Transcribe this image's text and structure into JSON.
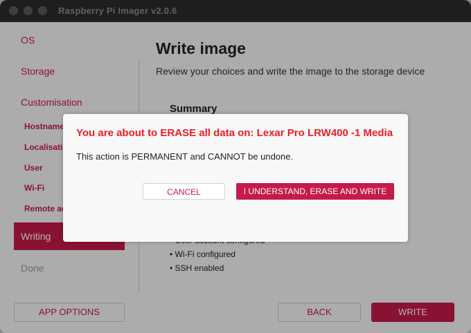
{
  "window": {
    "title": "Raspberry Pi Imager v2.0.6"
  },
  "sidebar": {
    "items": [
      {
        "label": "OS"
      },
      {
        "label": "Storage"
      },
      {
        "label": "Customisation"
      }
    ],
    "sub_items": [
      {
        "label": "Hostname"
      },
      {
        "label": "Localisation"
      },
      {
        "label": "User"
      },
      {
        "label": "Wi-Fi"
      },
      {
        "label": "Remote access"
      }
    ],
    "active": {
      "label": "Writing"
    },
    "done": {
      "label": "Done"
    }
  },
  "main": {
    "heading": "Write image",
    "subheading": "Review your choices and write the image to the storage device",
    "summary_title": "Summary",
    "bullets": [
      "• User account configured",
      "• Wi-Fi configured",
      "• SSH enabled"
    ]
  },
  "footer": {
    "app_options_label": "APP OPTIONS",
    "back_label": "BACK",
    "write_label": "WRITE"
  },
  "dialog": {
    "title": "You are about to ERASE all data on: Lexar Pro LRW400 -1 Media",
    "body": "This action is PERMANENT and CANNOT be undone.",
    "cancel_label": "CANCEL",
    "confirm_label": "I UNDERSTAND, ERASE AND WRITE"
  },
  "colors": {
    "accent": "#c51a4a",
    "warning": "#ee1c25",
    "titlebar": "#2b2b2b"
  }
}
